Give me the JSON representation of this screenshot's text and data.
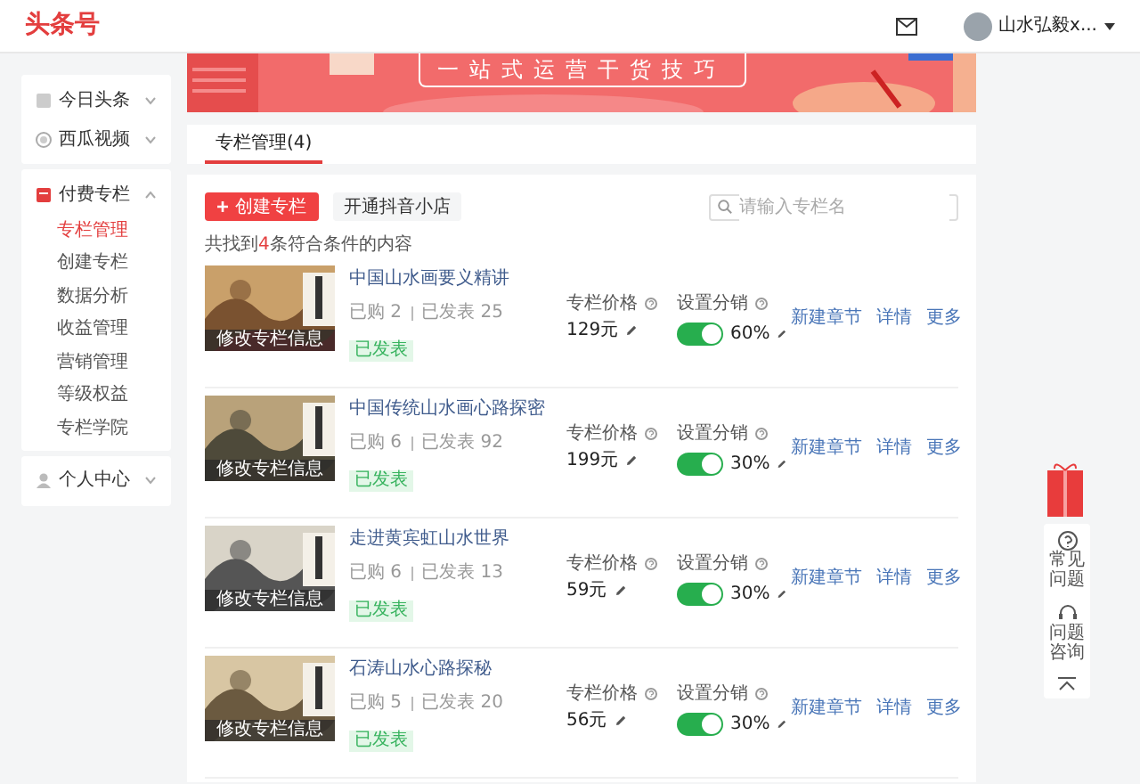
{
  "header": {
    "logo": "头条号",
    "user_name": "山水弘毅x..."
  },
  "sidebar": {
    "groups": [
      {
        "kind": "links",
        "items": [
          {
            "label": "今日头条"
          },
          {
            "label": "西瓜视频"
          }
        ]
      },
      {
        "kind": "section",
        "title": "付费专栏",
        "expanded": true,
        "items": [
          {
            "label": "专栏管理",
            "selected": true
          },
          {
            "label": "创建专栏",
            "selected": false
          },
          {
            "label": "数据分析",
            "selected": false
          },
          {
            "label": "收益管理",
            "selected": false
          },
          {
            "label": "营销管理",
            "selected": false
          },
          {
            "label": "等级权益",
            "selected": false
          },
          {
            "label": "专栏学院",
            "selected": false
          }
        ]
      },
      {
        "kind": "section",
        "title": "个人中心",
        "expanded": false
      }
    ]
  },
  "banner": {
    "slogan": "一站式运营干货技巧"
  },
  "tabs": [
    {
      "label": "专栏管理(4)",
      "selected": true
    }
  ],
  "toolbar": {
    "create_button": "创建专栏",
    "shop_button": "开通抖音小店",
    "search": {
      "placeholder": "请输入专栏名"
    }
  },
  "result": {
    "prefix": "共找到",
    "count": "4",
    "suffix": "条符合条件的内容"
  },
  "columns": [
    {
      "cover_label": "修改专栏信息",
      "title": "中国山水画要义精讲",
      "purchased": "已购 2",
      "published": "已发表 25",
      "status": "已发表",
      "price_label": "专栏价格",
      "price": "129元",
      "distribution_label": "设置分销",
      "distribution_on": true,
      "distribution_rate": "60%",
      "actions": [
        "新建章节",
        "详情",
        "更多"
      ]
    },
    {
      "cover_label": "修改专栏信息",
      "title": "中国传统山水画心路探密",
      "purchased": "已购 6",
      "published": "已发表 92",
      "status": "已发表",
      "price_label": "专栏价格",
      "price": "199元",
      "distribution_label": "设置分销",
      "distribution_on": true,
      "distribution_rate": "30%",
      "actions": [
        "新建章节",
        "详情",
        "更多"
      ]
    },
    {
      "cover_label": "修改专栏信息",
      "title": "走进黄宾虹山水世界",
      "purchased": "已购 6",
      "published": "已发表 13",
      "status": "已发表",
      "price_label": "专栏价格",
      "price": "59元",
      "distribution_label": "设置分销",
      "distribution_on": true,
      "distribution_rate": "30%",
      "actions": [
        "新建章节",
        "详情",
        "更多"
      ]
    },
    {
      "cover_label": "修改专栏信息",
      "title": "石涛山水心路探秘",
      "purchased": "已购 5",
      "published": "已发表 20",
      "status": "已发表",
      "price_label": "专栏价格",
      "price": "56元",
      "distribution_label": "设置分销",
      "distribution_on": true,
      "distribution_rate": "30%",
      "actions": [
        "新建章节",
        "详情",
        "更多"
      ]
    }
  ],
  "float_panel": {
    "items": [
      {
        "label": "常见问题"
      },
      {
        "label": "问题咨询"
      }
    ]
  }
}
